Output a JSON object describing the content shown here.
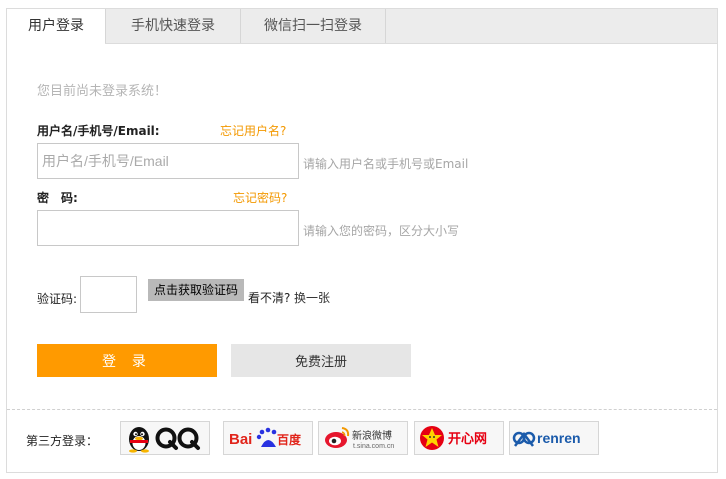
{
  "tabs": [
    {
      "label": "用户登录",
      "active": true
    },
    {
      "label": "手机快速登录",
      "active": false
    },
    {
      "label": "微信扫一扫登录",
      "active": false
    }
  ],
  "notice": "您目前尚未登录系统！",
  "username": {
    "label": "用户名/手机号/Email:",
    "forgot": "忘记用户名?",
    "placeholder": "用户名/手机号/Email",
    "hint": "请输入用户名或手机号或Email"
  },
  "password": {
    "label": "密　码:",
    "forgot": "忘记密码?",
    "hint": "请输入您的密码，区分大小写"
  },
  "captcha": {
    "label": "验证码:",
    "button": "点击获取验证码",
    "unclear": "看不清?",
    "refresh": "换一张"
  },
  "buttons": {
    "login": "登 录",
    "register": "免费注册"
  },
  "third_party": {
    "label": "第三方登录：",
    "providers": [
      {
        "name": "QQ",
        "icon": "qq-penguin-icon"
      },
      {
        "name": "Bai百度",
        "icon": "baidu-paw-icon"
      },
      {
        "name": "新浪微博",
        "sub": "t.sina.com.cn",
        "icon": "weibo-eye-icon"
      },
      {
        "name": "开心网",
        "icon": "kaixin-star-icon"
      },
      {
        "name": "renren",
        "icon": "renren-logo-icon"
      }
    ]
  },
  "colors": {
    "accent": "#ff9a00",
    "link": "#f39800",
    "tab_bar": "#ececec"
  }
}
